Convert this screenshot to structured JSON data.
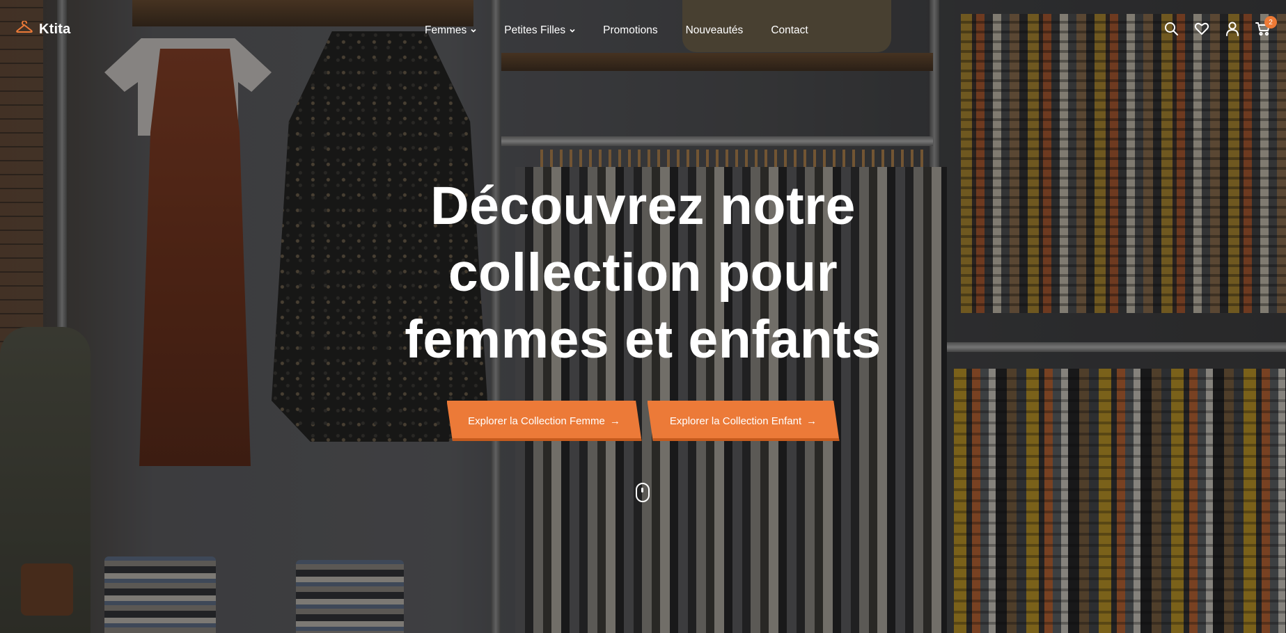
{
  "brand": {
    "name": "Ktita",
    "logo_icon": "hanger-icon",
    "accent_color": "#ec7a38"
  },
  "nav": {
    "items": [
      {
        "label": "Femmes",
        "has_dropdown": true
      },
      {
        "label": "Petites Filles",
        "has_dropdown": true
      },
      {
        "label": "Promotions",
        "has_dropdown": false
      },
      {
        "label": "Nouveautés",
        "has_dropdown": false
      },
      {
        "label": "Contact",
        "has_dropdown": false
      }
    ]
  },
  "header_icons": {
    "search": "search-icon",
    "wishlist": "heart-icon",
    "account": "user-icon",
    "cart": "cart-icon",
    "cart_count": "2"
  },
  "hero": {
    "title_line1": "Découvrez notre",
    "title_line2": "collection pour",
    "title_line3": "femmes et enfants",
    "cta_women": "Explorer la Collection Femme",
    "cta_kids": "Explorer la Collection Enfant",
    "cta_arrow": "→",
    "scroll_indicator": "mouse-scroll-icon"
  }
}
